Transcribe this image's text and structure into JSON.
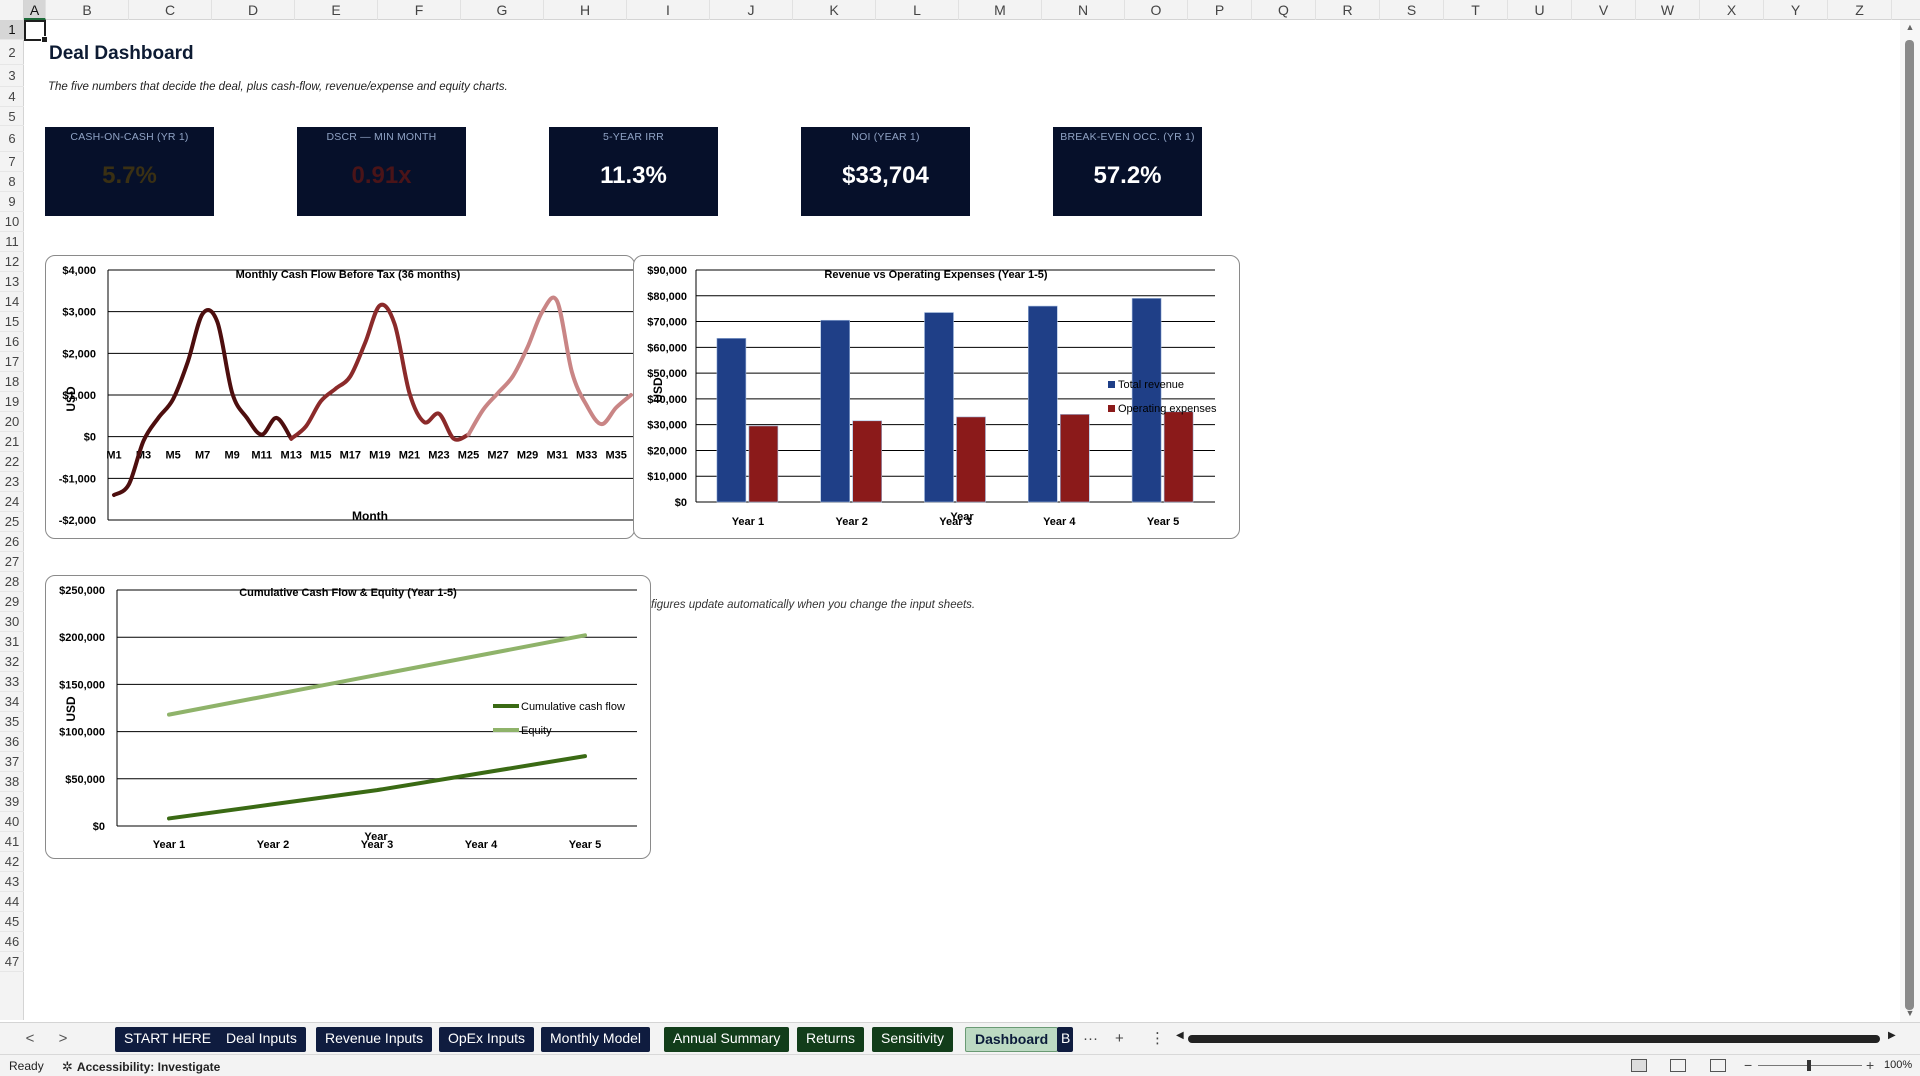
{
  "sheet": {
    "title": "Deal Dashboard",
    "subtitle": "The five numbers that decide the deal, plus cash-flow, revenue/expense and equity charts.",
    "note": "figures update automatically when you change the input sheets."
  },
  "columns": [
    "A",
    "B",
    "C",
    "D",
    "E",
    "F",
    "G",
    "H",
    "I",
    "J",
    "K",
    "L",
    "M",
    "N",
    "O",
    "P",
    "Q",
    "R",
    "S",
    "T",
    "U",
    "V",
    "W",
    "X",
    "Y",
    "Z"
  ],
  "rows": [
    "1",
    "2",
    "3",
    "4",
    "5",
    "6",
    "7",
    "8",
    "9",
    "10",
    "11",
    "12",
    "13",
    "14",
    "15",
    "16",
    "17",
    "18",
    "19",
    "20",
    "21",
    "22",
    "23",
    "24",
    "25",
    "26",
    "27",
    "28",
    "29",
    "30",
    "31",
    "32",
    "33",
    "34",
    "35",
    "36",
    "37",
    "38",
    "39",
    "40",
    "41",
    "42",
    "43",
    "44",
    "45",
    "46",
    "47"
  ],
  "active_cell": "A1",
  "kpis": [
    {
      "label": "CASH-ON-CASH (YR 1)",
      "value": "5.7%",
      "color": "#3a3013"
    },
    {
      "label": "DSCR — MIN MONTH",
      "value": "0.91x",
      "color": "#4a1418"
    },
    {
      "label": "5-YEAR IRR",
      "value": "11.3%",
      "color": "#ffffff"
    },
    {
      "label": "NOI (YEAR 1)",
      "value": "$33,704",
      "color": "#ffffff"
    },
    {
      "label": "BREAK-EVEN OCC. (YR 1)",
      "value": "57.2%",
      "color": "#ffffff"
    }
  ],
  "charts": {
    "cashflow": {
      "type": "line",
      "title": "Monthly Cash Flow Before Tax (36 months)",
      "xlabel": "Month",
      "ylabel": "USD",
      "ylim": [
        -2000,
        4000
      ],
      "ytick_labels": [
        "$4,000",
        "$3,000",
        "$2,000",
        "$1,000",
        "$0",
        "-$1,000",
        "-$2,000"
      ],
      "xtick_labels": [
        "M1",
        "M3",
        "M5",
        "M7",
        "M9",
        "M11",
        "M13",
        "M15",
        "M17",
        "M19",
        "M21",
        "M23",
        "M25",
        "M27",
        "M29",
        "M31",
        "M33",
        "M35"
      ],
      "segment_colors": [
        "#4d0e0e",
        "#8b2a2a",
        "#c98585"
      ]
    },
    "revenue": {
      "type": "bar",
      "title": "Revenue vs Operating Expenses (Year 1-5)",
      "xlabel": "Year",
      "ylabel": "USD",
      "ylim": [
        0,
        90000
      ],
      "ytick_labels": [
        "$90,000",
        "$80,000",
        "$70,000",
        "$60,000",
        "$50,000",
        "$40,000",
        "$30,000",
        "$20,000",
        "$10,000",
        "$0"
      ],
      "legend_position": "right"
    },
    "cumulative": {
      "type": "line",
      "title": "Cumulative Cash Flow & Equity (Year 1-5)",
      "xlabel": "Year",
      "ylabel": "USD",
      "ylim": [
        0,
        250000
      ],
      "ytick_labels": [
        "$250,000",
        "$200,000",
        "$150,000",
        "$100,000",
        "$50,000",
        "$0"
      ],
      "legend_position": "right"
    }
  },
  "chart_data": [
    {
      "type": "line",
      "title": "Monthly Cash Flow Before Tax (36 months)",
      "xlabel": "Month",
      "ylabel": "USD",
      "ylim": [
        -2000,
        4000
      ],
      "x": [
        "M1",
        "M2",
        "M3",
        "M4",
        "M5",
        "M6",
        "M7",
        "M8",
        "M9",
        "M10",
        "M11",
        "M12",
        "M13",
        "M14",
        "M15",
        "M16",
        "M17",
        "M18",
        "M19",
        "M20",
        "M21",
        "M22",
        "M23",
        "M24",
        "M25",
        "M26",
        "M27",
        "M28",
        "M29",
        "M30",
        "M31",
        "M32",
        "M33",
        "M34",
        "M35",
        "M36"
      ],
      "series": [
        {
          "values": [
            -1400,
            -1150,
            -100,
            450,
            900,
            1800,
            2950,
            2750,
            1050,
            450,
            50,
            450,
            -50,
            250,
            850,
            1150,
            1450,
            2250,
            3150,
            2700,
            1050,
            350,
            550,
            -50,
            50,
            650,
            1050,
            1450,
            2150,
            3000,
            3250,
            1550,
            750,
            300,
            700,
            1000
          ]
        }
      ]
    },
    {
      "type": "bar",
      "title": "Revenue vs Operating Expenses (Year 1-5)",
      "xlabel": "Year",
      "ylabel": "USD",
      "ylim": [
        0,
        90000
      ],
      "categories": [
        "Year 1",
        "Year 2",
        "Year 3",
        "Year 4",
        "Year 5"
      ],
      "series": [
        {
          "name": "Total revenue",
          "values": [
            63500,
            70500,
            73500,
            76000,
            79000
          ],
          "color": "#1f3f87"
        },
        {
          "name": "Operating expenses",
          "values": [
            29500,
            31500,
            33000,
            34000,
            35000
          ],
          "color": "#8b1a1a"
        }
      ]
    },
    {
      "type": "line",
      "title": "Cumulative Cash Flow & Equity (Year 1-5)",
      "xlabel": "Year",
      "ylabel": "USD",
      "ylim": [
        0,
        250000
      ],
      "categories": [
        "Year 1",
        "Year 2",
        "Year 3",
        "Year 4",
        "Year 5"
      ],
      "series": [
        {
          "name": "Cumulative cash flow",
          "values": [
            8000,
            23000,
            38000,
            56000,
            74000
          ],
          "color": "#3a6a14"
        },
        {
          "name": "Equity",
          "values": [
            118000,
            139000,
            160000,
            181000,
            202000
          ],
          "color": "#8fb36a"
        }
      ]
    }
  ],
  "tabs": [
    {
      "label": "START HERE",
      "style": "navy"
    },
    {
      "label": "Deal Inputs",
      "style": "navy"
    },
    {
      "label": "Revenue Inputs",
      "style": "navy"
    },
    {
      "label": "OpEx Inputs",
      "style": "navy"
    },
    {
      "label": "Monthly Model",
      "style": "navy"
    },
    {
      "label": "Annual Summary",
      "style": "green"
    },
    {
      "label": "Returns",
      "style": "green"
    },
    {
      "label": "Sensitivity",
      "style": "green"
    },
    {
      "label": "Dashboard",
      "style": "active"
    },
    {
      "label": "B",
      "style": "navy"
    }
  ],
  "tab_controls": {
    "prev": "<",
    "next": ">",
    "more": "···",
    "add": "+",
    "options": "⋮"
  },
  "status": {
    "ready": "Ready",
    "accessibility": "Accessibility: Investigate",
    "zoom": "100%"
  }
}
